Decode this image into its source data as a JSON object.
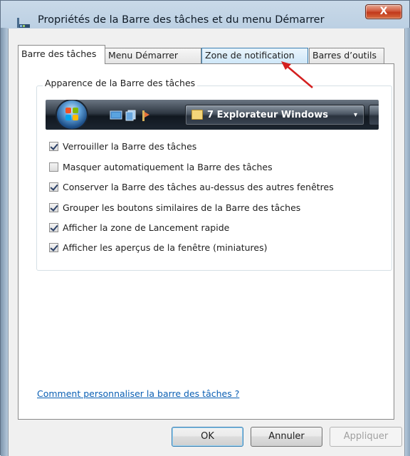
{
  "window": {
    "title": "Propriétés de la Barre des tâches et du menu Démarrer",
    "close_glyph": "X"
  },
  "tabs": [
    {
      "label": "Barre des tâches",
      "active": true
    },
    {
      "label": "Menu Démarrer",
      "active": false
    },
    {
      "label": "Zone de notification",
      "active": false,
      "highlighted": true
    },
    {
      "label": "Barres d’outils",
      "active": false
    }
  ],
  "group": {
    "label": "Apparence de la Barre des tâches",
    "preview": {
      "button_label": "7 Explorateur Windows",
      "caret_glyph": "▾"
    }
  },
  "options": [
    {
      "label": "Verrouiller la Barre des tâches",
      "checked": true
    },
    {
      "label": "Masquer automatiquement la Barre des tâches",
      "checked": false
    },
    {
      "label": "Conserver la Barre des tâches au-dessus des autres fenêtres",
      "checked": true
    },
    {
      "label": "Grouper les boutons similaires de la Barre des tâches",
      "checked": true
    },
    {
      "label": "Afficher la zone de Lancement rapide",
      "checked": true
    },
    {
      "label": "Afficher les aperçus de la fenêtre (miniatures)",
      "checked": true
    }
  ],
  "help_link": "Comment personnaliser la barre des tâches ?",
  "buttons": {
    "ok": "OK",
    "cancel": "Annuler",
    "apply": "Appliquer"
  },
  "colors": {
    "arrow": "#d42020",
    "link": "#0a5fb4",
    "tab_highlight": "#cfe7f8"
  },
  "icons": {
    "app": "taskbar-properties-icon",
    "close": "close-icon",
    "start_orb": "windows-start-orb-icon",
    "folder": "folder-icon"
  }
}
